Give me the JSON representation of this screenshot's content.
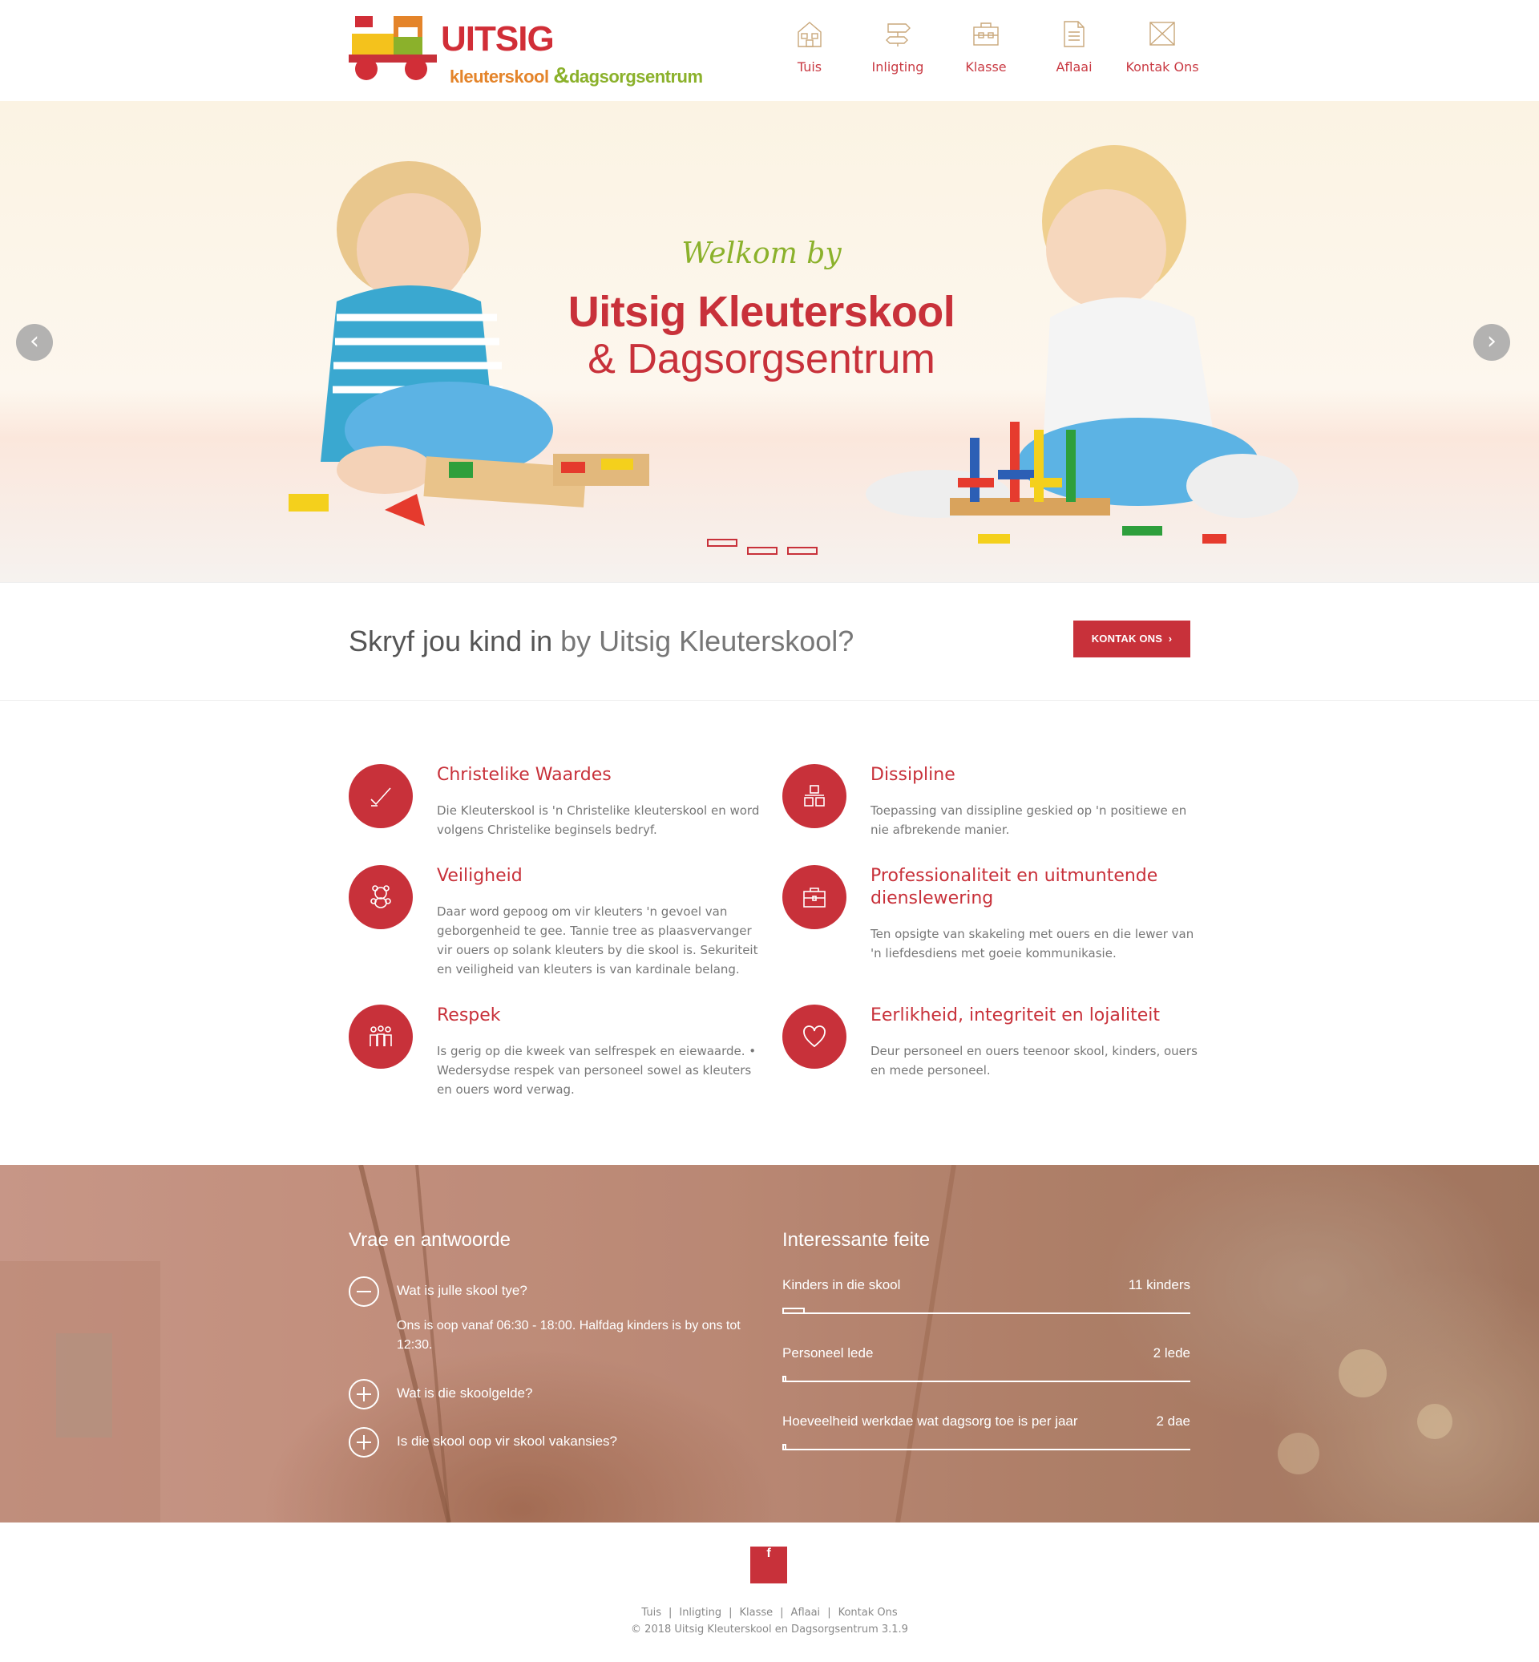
{
  "logo": {
    "brand": "UITSIG",
    "sub1": "kleuterskool",
    "amp": "&",
    "sub2": "dagsorgsentrum"
  },
  "nav": [
    {
      "label": "Tuis",
      "icon": "house-icon"
    },
    {
      "label": "Inligting",
      "icon": "signpost-icon"
    },
    {
      "label": "Klasse",
      "icon": "toolbox-icon"
    },
    {
      "label": "Aflaai",
      "icon": "document-icon"
    },
    {
      "label": "Kontak Ons",
      "icon": "envelope-icon"
    }
  ],
  "hero": {
    "welkom": "Welkom by",
    "title": "Uitsig Kleuterskool",
    "subtitle": "& Dagsorgsentrum",
    "prev": "‹",
    "next": "›",
    "slide_count": 3,
    "active_slide": 1
  },
  "cta": {
    "bold": "Skryf jou kind in",
    "light": "by Uitsig Kleuterskool?",
    "button": "KONTAK ONS",
    "button_arrow": "›"
  },
  "features": [
    {
      "title": "Christelike Waardes",
      "text": "Die Kleuterskool is 'n Christelike kleuterskool en word volgens Christelike beginsels bedryf.",
      "icon": "checkmark-icon"
    },
    {
      "title": "Dissipline",
      "text": "Toepassing van dissipline geskied op 'n positiewe en nie afbrekende manier.",
      "icon": "blocks-icon"
    },
    {
      "title": "Veiligheid",
      "text": "Daar word gepoog om vir kleuters 'n gevoel van geborgenheid te gee. Tannie tree as plaasvervanger vir ouers op solank kleuters by die skool is. Sekuriteit en veiligheid van kleuters is van kardinale belang.",
      "icon": "teddy-bear-icon"
    },
    {
      "title": "Professionaliteit en uitmuntende dienslewering",
      "text": "Ten opsigte van skakeling met ouers en die lewer van 'n liefdesdiens met goeie kommunikasie.",
      "icon": "briefcase-icon"
    },
    {
      "title": "Respek",
      "text": "Is gerig op die kweek van selfrespek en eiewaarde. • Wedersydse respek van personeel sowel as kleuters en ouers word verwag.",
      "icon": "people-icon"
    },
    {
      "title": "Eerlikheid, integriteit en lojaliteit",
      "text": "Deur personeel en ouers teenoor skool, kinders, ouers en mede personeel.",
      "icon": "heart-icon"
    }
  ],
  "faq": {
    "heading": "Vrae en antwoorde",
    "items": [
      {
        "q": "Wat is julle skool tye?",
        "a": "Ons is oop vanaf 06:30 - 18:00. Halfdag kinders is by ons tot 12:30.",
        "open": true
      },
      {
        "q": "Wat is die skoolgelde?",
        "a": "",
        "open": false
      },
      {
        "q": "Is die skool oop vir skool vakansies?",
        "a": "",
        "open": false
      }
    ]
  },
  "facts": {
    "heading": "Interessante feite",
    "items": [
      {
        "label": "Kinders in die skool",
        "value": "11 kinders",
        "progress": 0.055
      },
      {
        "label": "Personeel lede",
        "value": "2 lede",
        "progress": 0.01
      },
      {
        "label": "Hoeveelheid werkdae wat dagsorg toe is per jaar",
        "value": "2 dae",
        "progress": 0.01
      }
    ]
  },
  "footer": {
    "fb": "f",
    "links": [
      "Tuis",
      "Inligting",
      "Klasse",
      "Aflaai",
      "Kontak Ons"
    ],
    "separator": "|",
    "copyright": "© 2018 Uitsig Kleuterskool en Dagsorgsentrum 3.1.9"
  },
  "colors": {
    "accent": "#c8313a",
    "green": "#8bb12b",
    "orange": "#e4842a"
  }
}
